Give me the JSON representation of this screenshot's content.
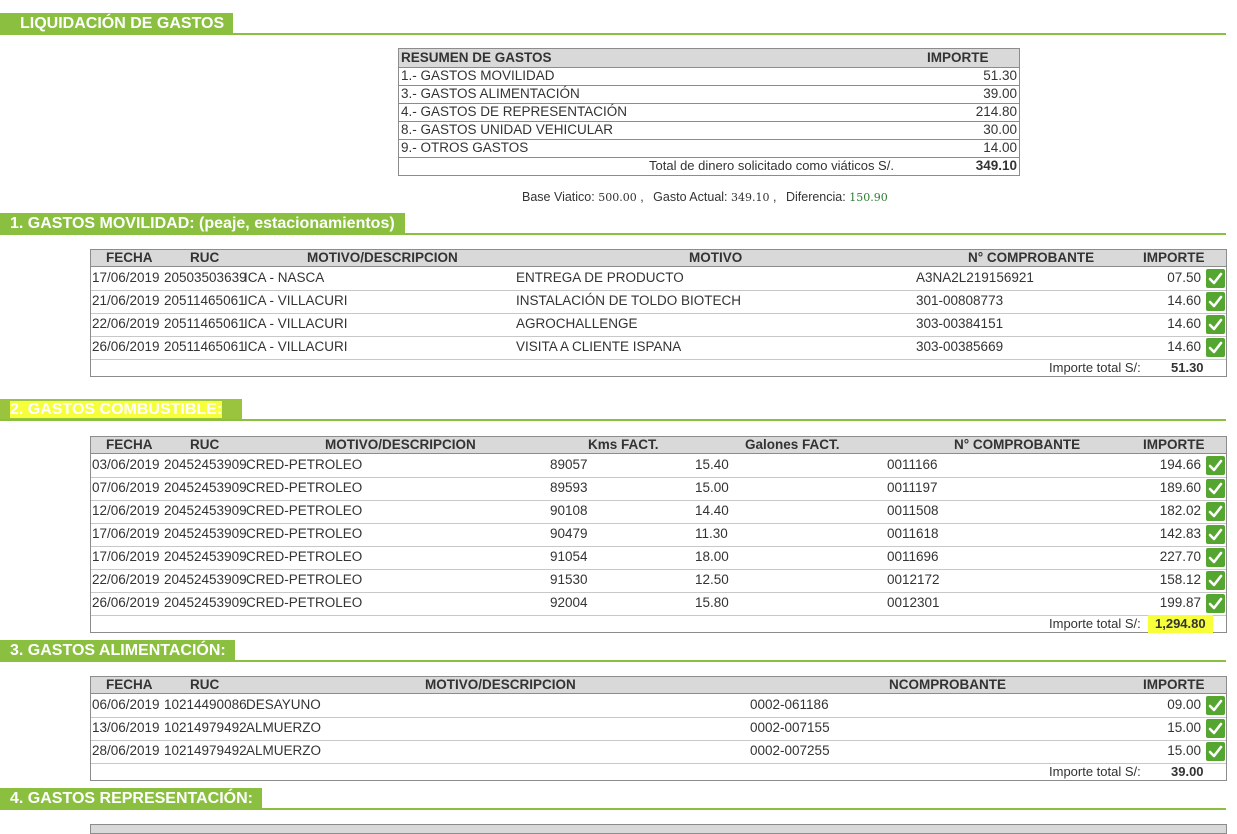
{
  "page_title": "LIQUIDACIÓN DE GASTOS",
  "summary": {
    "header_label": "RESUMEN DE GASTOS",
    "header_amount": "IMPORTE",
    "rows": [
      {
        "label": "1.- GASTOS MOVILIDAD",
        "amount": "51.30"
      },
      {
        "label": "3.- GASTOS ALIMENTACIÓN",
        "amount": "39.00"
      },
      {
        "label": "4.- GASTOS DE REPRESENTACIÓN",
        "amount": "214.80"
      },
      {
        "label": "8.- GASTOS UNIDAD VEHICULAR",
        "amount": "30.00"
      },
      {
        "label": "9.- OTROS GASTOS",
        "amount": "14.00"
      }
    ],
    "total_label": "Total de dinero solicitado como viáticos S/.",
    "total_amount": "349.10"
  },
  "base": {
    "base_label": "Base Viatico:",
    "base_value": "500.00",
    "actual_label": "Gasto Actual:",
    "actual_value": "349.10",
    "diff_label": "Diferencia:",
    "diff_value": "150.90",
    "separator": ","
  },
  "movilidad": {
    "title": "1. GASTOS MOVILIDAD: (peaje, estacionamientos)",
    "headers": {
      "fecha": "FECHA",
      "ruc": "RUC",
      "motivo_desc": "MOTIVO/DESCRIPCION",
      "motivo": "MOTIVO",
      "comprobante": "N° COMPROBANTE",
      "importe": "IMPORTE"
    },
    "rows": [
      {
        "fecha": "17/06/2019",
        "ruc": "20503503639",
        "desc": "ICA - NASCA",
        "motivo": "ENTREGA DE PRODUCTO",
        "comprobante": "A3NA2L219156921",
        "importe": "07.50"
      },
      {
        "fecha": "21/06/2019",
        "ruc": "20511465061",
        "desc": "ICA - VILLACURI",
        "motivo": "INSTALACIÓN DE TOLDO BIOTECH",
        "comprobante": "301-00808773",
        "importe": "14.60"
      },
      {
        "fecha": "22/06/2019",
        "ruc": "20511465061",
        "desc": "ICA - VILLACURI",
        "motivo": "AGROCHALLENGE",
        "comprobante": "303-00384151",
        "importe": "14.60"
      },
      {
        "fecha": "26/06/2019",
        "ruc": "20511465061",
        "desc": "ICA - VILLACURI",
        "motivo": "VISITA A CLIENTE ISPANA",
        "comprobante": "303-00385669",
        "importe": "14.60"
      }
    ],
    "total_label": "Importe total S/:",
    "total_value": "51.30"
  },
  "combustible": {
    "title": "2. GASTOS COMBUSTIBLE:",
    "headers": {
      "fecha": "FECHA",
      "ruc": "RUC",
      "motivo_desc": "MOTIVO/DESCRIPCION",
      "kms": "Kms FACT.",
      "galones": "Galones FACT.",
      "comprobante": "N° COMPROBANTE",
      "importe": "IMPORTE"
    },
    "rows": [
      {
        "fecha": "03/06/2019",
        "ruc": "20452453909",
        "desc": "CRED-PETROLEO",
        "kms": "89057",
        "galones": "15.40",
        "comprobante": "0011166",
        "importe": "194.66"
      },
      {
        "fecha": "07/06/2019",
        "ruc": "20452453909",
        "desc": "CRED-PETROLEO",
        "kms": "89593",
        "galones": "15.00",
        "comprobante": "0011197",
        "importe": "189.60"
      },
      {
        "fecha": "12/06/2019",
        "ruc": "20452453909",
        "desc": "CRED-PETROLEO",
        "kms": "90108",
        "galones": "14.40",
        "comprobante": "0011508",
        "importe": "182.02"
      },
      {
        "fecha": "17/06/2019",
        "ruc": "20452453909",
        "desc": "CRED-PETROLEO",
        "kms": "90479",
        "galones": "11.30",
        "comprobante": "0011618",
        "importe": "142.83"
      },
      {
        "fecha": "17/06/2019",
        "ruc": "20452453909",
        "desc": "CRED-PETROLEO",
        "kms": "91054",
        "galones": "18.00",
        "comprobante": "0011696",
        "importe": "227.70"
      },
      {
        "fecha": "22/06/2019",
        "ruc": "20452453909",
        "desc": "CRED-PETROLEO",
        "kms": "91530",
        "galones": "12.50",
        "comprobante": "0012172",
        "importe": "158.12"
      },
      {
        "fecha": "26/06/2019",
        "ruc": "20452453909",
        "desc": "CRED-PETROLEO",
        "kms": "92004",
        "galones": "15.80",
        "comprobante": "0012301",
        "importe": "199.87"
      }
    ],
    "total_label": "Importe total S/:",
    "total_value": "1,294.80"
  },
  "alimentacion": {
    "title": "3. GASTOS ALIMENTACIÓN:",
    "headers": {
      "fecha": "FECHA",
      "ruc": "RUC",
      "motivo_desc": "MOTIVO/DESCRIPCION",
      "comprobante": "NCOMPROBANTE",
      "importe": "IMPORTE"
    },
    "rows": [
      {
        "fecha": "06/06/2019",
        "ruc": "10214490086",
        "desc": "DESAYUNO",
        "comprobante": "0002-061186",
        "importe": "09.00"
      },
      {
        "fecha": "13/06/2019",
        "ruc": "10214979492",
        "desc": "ALMUERZO",
        "comprobante": "0002-007155",
        "importe": "15.00"
      },
      {
        "fecha": "28/06/2019",
        "ruc": "10214979492",
        "desc": "ALMUERZO",
        "comprobante": "0002-007255",
        "importe": "15.00"
      }
    ],
    "total_label": "Importe total S/:",
    "total_value": "39.00"
  },
  "representacion": {
    "title": "4. GASTOS REPRESENTACIÓN:"
  },
  "colors": {
    "accent": "#8bbf40",
    "check": "#55a630",
    "highlight": "#f6ff3a"
  }
}
